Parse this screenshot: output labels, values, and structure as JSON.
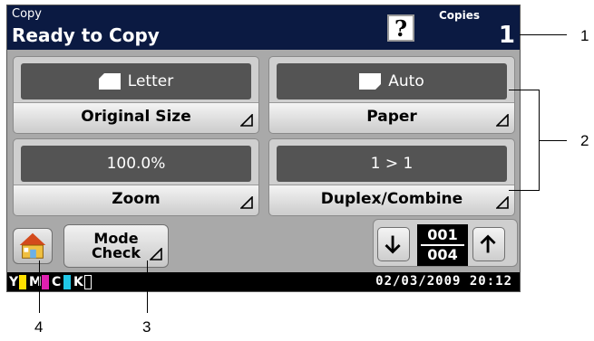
{
  "header": {
    "mode": "Copy",
    "status": "Ready to Copy",
    "help_symbol": "?",
    "copies_label": "Copies",
    "copies_value": "1"
  },
  "tiles": {
    "original_size": {
      "value": "Letter",
      "label": "Original Size"
    },
    "paper": {
      "value": "Auto",
      "label": "Paper"
    },
    "zoom": {
      "value": "100.0%",
      "label": "Zoom"
    },
    "duplex": {
      "value": "1 > 1",
      "label": "Duplex/Combine"
    }
  },
  "bottom": {
    "mode_check_line1": "Mode",
    "mode_check_line2": "Check",
    "page_current": "001",
    "page_total": "004"
  },
  "status_bar": {
    "toner_labels": [
      "Y",
      "M",
      "C",
      "K"
    ],
    "toner_colors": [
      "#ffe000",
      "#e020b0",
      "#20c8e8",
      "#000000"
    ],
    "datetime": "02/03/2009  20:12"
  },
  "callouts": [
    "1",
    "2",
    "3",
    "4"
  ],
  "colors": {
    "header_bg": "#0b1a42",
    "panel_bg": "#a9a9a9",
    "value_bg": "#545454"
  }
}
